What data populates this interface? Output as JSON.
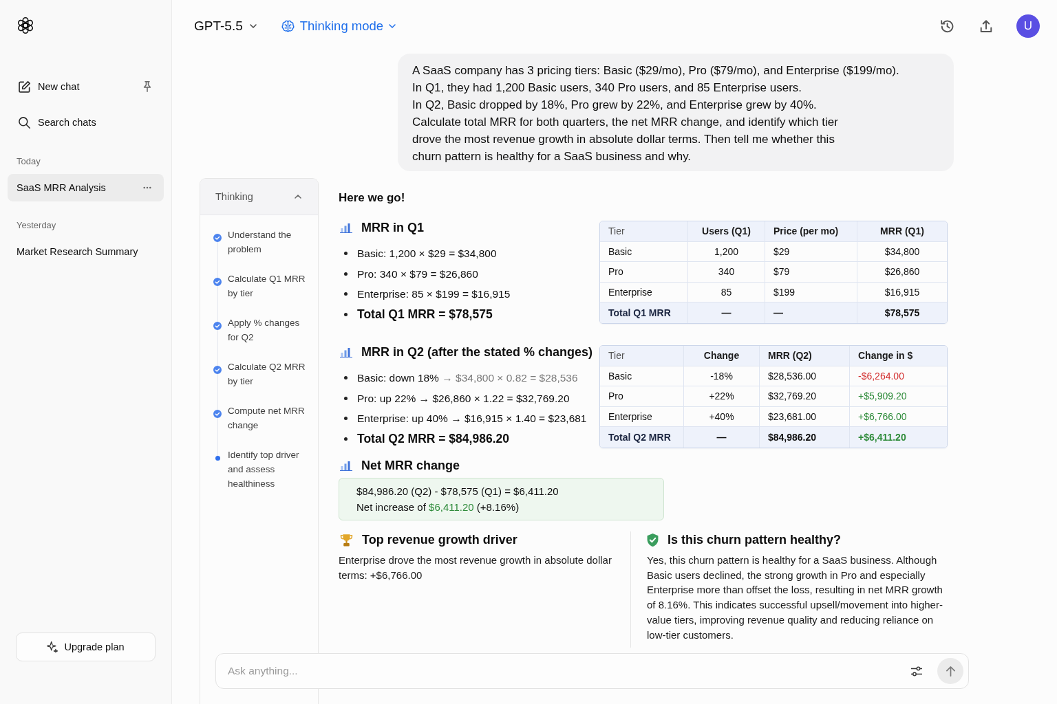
{
  "sidebar": {
    "new_chat": "New chat",
    "search": "Search chats",
    "groups": [
      {
        "label": "Today",
        "items": [
          {
            "title": "SaaS MRR Analysis",
            "selected": true
          }
        ]
      },
      {
        "label": "Yesterday",
        "items": [
          {
            "title": "Market Research Summary",
            "selected": false
          }
        ]
      }
    ],
    "upgrade": "Upgrade plan"
  },
  "header": {
    "model": "GPT-5.5",
    "mode": "Thinking mode",
    "avatar": "U"
  },
  "user_message": {
    "lines": [
      "A SaaS company has 3 pricing tiers: Basic ($29/mo), Pro ($79/mo), and Enterprise ($199/mo).",
      "In Q1, they had 1,200 Basic users, 340 Pro users, and 85 Enterprise users.",
      "In Q2, Basic dropped by 18%, Pro grew by 22%, and Enterprise grew by 40%.",
      "Calculate total MRR for both quarters, the net MRR change, and identify which tier",
      "drove the most revenue growth in absolute dollar terms. Then tell me whether this",
      "churn pattern is healthy for a SaaS business and why."
    ]
  },
  "thinking": {
    "title": "Thinking",
    "expanded": true,
    "steps": [
      {
        "label": "Understand the problem",
        "done": true
      },
      {
        "label": "Calculate Q1 MRR by tier",
        "done": true
      },
      {
        "label": "Apply % changes for Q2",
        "done": true
      },
      {
        "label": "Calculate Q2 MRR by tier",
        "done": true
      },
      {
        "label": "Compute net MRR change",
        "done": true
      },
      {
        "label": "Identify top driver and assess healthiness",
        "done": false
      }
    ]
  },
  "answer": {
    "intro": "Here we go!",
    "sections": [
      {
        "kind": "calc",
        "title": "MRR in Q1",
        "bullets": [
          {
            "text": "Basic: 1,200 × $29 = $34,800",
            "total": false
          },
          {
            "text": "Pro: 340 × $79 = $26,860",
            "total": false
          },
          {
            "text": "Enterprise: 85 × $199 = $16,915",
            "total": false
          },
          {
            "text": "Total Q1 MRR = $78,575",
            "total": true
          }
        ],
        "table": {
          "columns": [
            "Tier",
            "Users (Q1)",
            "Price (per mo)",
            "MRR (Q1)"
          ],
          "rows": [
            {
              "cells": [
                "Basic",
                "1,200",
                "$29",
                "$34,800"
              ],
              "total": false
            },
            {
              "cells": [
                "Pro",
                "340",
                "$79",
                "$26,860"
              ],
              "total": false
            },
            {
              "cells": [
                "Enterprise",
                "85",
                "$199",
                "$16,915"
              ],
              "total": false
            },
            {
              "cells": [
                "Total Q1 MRR",
                "—",
                "—",
                "$78,575"
              ],
              "total": true
            }
          ]
        }
      },
      {
        "kind": "calc",
        "title": "MRR in Q2 (after the stated % changes)",
        "bullets": [
          {
            "text": "Basic: down 18% ",
            "muted": "→ $34,800 × 0.82 = $28,536",
            "total": false
          },
          {
            "text": "Pro: up 22% → $26,860 × 1.22 = $32,769.20",
            "total": false
          },
          {
            "text": "Enterprise: up 40% → $16,915 × 1.40 = $23,681",
            "total": false
          },
          {
            "text": "Total Q2 MRR = $84,986.20",
            "total": true
          }
        ],
        "table": {
          "columns": [
            "Tier",
            "Change",
            "MRR (Q2)",
            "Change in $"
          ],
          "rows": [
            {
              "cells": [
                "Basic",
                "-18%",
                "$28,536.00",
                "-$6,264.00"
              ],
              "color": "#d32f2f",
              "total": false
            },
            {
              "cells": [
                "Pro",
                "+22%",
                "$32,769.20",
                "+$5,909.20"
              ],
              "color": "#2e8b3a",
              "total": false
            },
            {
              "cells": [
                "Enterprise",
                "+40%",
                "$23,681.00",
                "+$6,766.00"
              ],
              "color": "#2e8b3a",
              "total": false
            },
            {
              "cells": [
                "Total Q2 MRR",
                "—",
                "$84,986.20",
                "+$6,411.20"
              ],
              "color": "#2e8b3a",
              "total": true
            }
          ]
        }
      },
      {
        "kind": "net",
        "title": "Net MRR change",
        "formula": "$84,986.20 (Q2) - $78,575 (Q1) = $6,411.20",
        "result": {
          "prefix": "Net increase of ",
          "amount": "$6,411.20",
          "suffix": " (+8.16%)"
        }
      }
    ],
    "findings": [
      {
        "kind": "driver",
        "title": "Top revenue growth driver",
        "text": "Enterprise drove the most revenue growth in absolute dollar terms: +$6,766.00"
      },
      {
        "kind": "verdict",
        "title": "Is this churn pattern healthy?",
        "text": "Yes, this churn pattern is healthy for a SaaS business. Although Basic users declined, the strong growth in Pro and especially Enterprise more than offset the loss, resulting in net MRR growth of 8.16%. This indicates successful upsell/movement into higher-value tiers, improving revenue quality and reducing reliance on low-tier customers."
      }
    ]
  },
  "composer": {
    "placeholder": "Ask anything..."
  }
}
